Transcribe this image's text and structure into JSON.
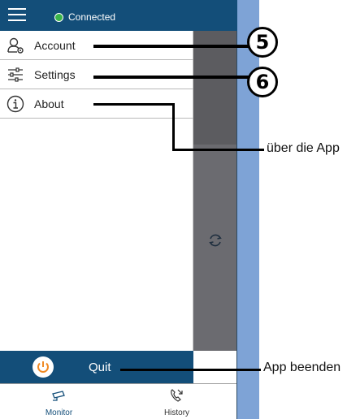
{
  "header": {
    "status_text": "Connected",
    "status_color": "#3ab54a",
    "bar_color": "#134e79"
  },
  "menu": {
    "items": [
      {
        "label": "Account",
        "icon": "account-icon"
      },
      {
        "label": "Settings",
        "icon": "sliders-icon"
      },
      {
        "label": "About",
        "icon": "info-icon"
      }
    ]
  },
  "quit": {
    "label": "Quit",
    "icon": "power-icon",
    "icon_color": "#f08a24"
  },
  "bottom_nav": [
    {
      "label": "Monitor",
      "icon": "camera-icon"
    },
    {
      "label": "History",
      "icon": "phone-history-icon"
    }
  ],
  "annotations": {
    "badge_account": "5",
    "badge_settings": "6",
    "about_note": "über die App",
    "quit_note": "App beenden"
  }
}
